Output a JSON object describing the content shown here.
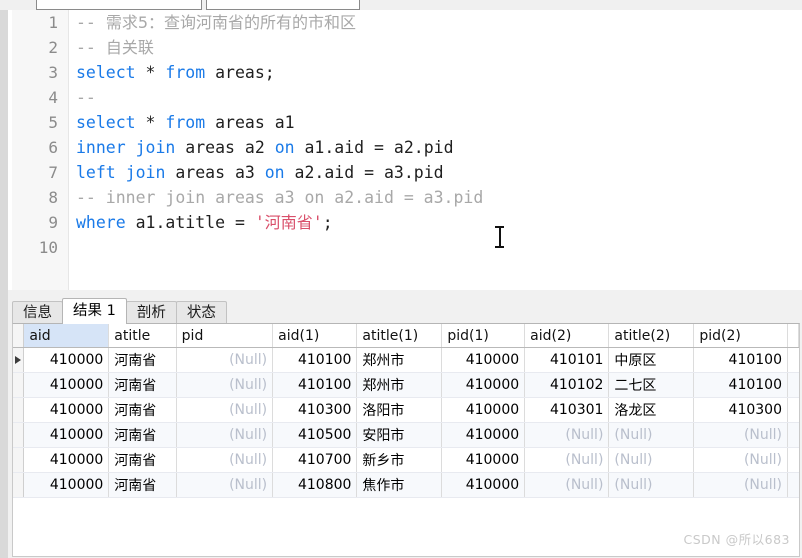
{
  "toolbar": {
    "box_one_label": "",
    "box_two_label": ""
  },
  "editor": {
    "lines": [
      {
        "no": "1",
        "segments": [
          {
            "t": "-- ",
            "c": "cm"
          },
          {
            "t": "需求5：查询河南省的所有的市和区",
            "c": "cm cn"
          }
        ]
      },
      {
        "no": "2",
        "segments": [
          {
            "t": "-- ",
            "c": "cm"
          },
          {
            "t": "自关联",
            "c": "cm cn"
          }
        ]
      },
      {
        "no": "3",
        "segments": [
          {
            "t": "select",
            "c": "kw"
          },
          {
            "t": " * ",
            "c": ""
          },
          {
            "t": "from",
            "c": "kw"
          },
          {
            "t": " areas;",
            "c": ""
          }
        ]
      },
      {
        "no": "4",
        "segments": [
          {
            "t": "--",
            "c": "cm"
          }
        ]
      },
      {
        "no": "5",
        "segments": [
          {
            "t": "select",
            "c": "kw"
          },
          {
            "t": " * ",
            "c": ""
          },
          {
            "t": "from",
            "c": "kw"
          },
          {
            "t": " areas a1",
            "c": ""
          }
        ]
      },
      {
        "no": "6",
        "segments": [
          {
            "t": "inner join",
            "c": "kw"
          },
          {
            "t": " areas a2 ",
            "c": ""
          },
          {
            "t": "on",
            "c": "kw"
          },
          {
            "t": " a1.aid = a2.pid",
            "c": ""
          }
        ]
      },
      {
        "no": "7",
        "segments": [
          {
            "t": "left join",
            "c": "kw"
          },
          {
            "t": " areas a3 ",
            "c": ""
          },
          {
            "t": "on",
            "c": "kw"
          },
          {
            "t": " a2.aid = a3.pid",
            "c": ""
          }
        ]
      },
      {
        "no": "8",
        "segments": [
          {
            "t": "-- inner join areas a3 on a2.aid = a3.pid",
            "c": "cm"
          }
        ]
      },
      {
        "no": "9",
        "segments": [
          {
            "t": "where",
            "c": "kw"
          },
          {
            "t": " a1.atitle = ",
            "c": ""
          },
          {
            "t": "'",
            "c": "str"
          },
          {
            "t": "河南省",
            "c": "str cn"
          },
          {
            "t": "'",
            "c": "str"
          },
          {
            "t": ";",
            "c": ""
          }
        ]
      },
      {
        "no": "10",
        "segments": []
      }
    ]
  },
  "results": {
    "tabs": [
      {
        "label": "信息",
        "active": false
      },
      {
        "label": "结果 1",
        "active": true
      },
      {
        "label": "剖析",
        "active": false
      },
      {
        "label": "状态",
        "active": false
      }
    ],
    "columns": [
      "aid",
      "atitle",
      "pid",
      "aid(1)",
      "atitle(1)",
      "pid(1)",
      "aid(2)",
      "atitle(2)",
      "pid(2)"
    ],
    "selected_column": "aid",
    "null_text": "(Null)",
    "current_row_index": 0,
    "rows": [
      {
        "aid": "410000",
        "atitle": "河南省",
        "pid": "(Null)",
        "aid1": "410100",
        "atitle1": "郑州市",
        "pid1": "410000",
        "aid2": "410101",
        "atitle2": "中原区",
        "pid2": "410100"
      },
      {
        "aid": "410000",
        "atitle": "河南省",
        "pid": "(Null)",
        "aid1": "410100",
        "atitle1": "郑州市",
        "pid1": "410000",
        "aid2": "410102",
        "atitle2": "二七区",
        "pid2": "410100"
      },
      {
        "aid": "410000",
        "atitle": "河南省",
        "pid": "(Null)",
        "aid1": "410300",
        "atitle1": "洛阳市",
        "pid1": "410000",
        "aid2": "410301",
        "atitle2": "洛龙区",
        "pid2": "410300"
      },
      {
        "aid": "410000",
        "atitle": "河南省",
        "pid": "(Null)",
        "aid1": "410500",
        "atitle1": "安阳市",
        "pid1": "410000",
        "aid2": "(Null)",
        "atitle2": "(Null)",
        "pid2": "(Null)"
      },
      {
        "aid": "410000",
        "atitle": "河南省",
        "pid": "(Null)",
        "aid1": "410700",
        "atitle1": "新乡市",
        "pid1": "410000",
        "aid2": "(Null)",
        "atitle2": "(Null)",
        "pid2": "(Null)"
      },
      {
        "aid": "410000",
        "atitle": "河南省",
        "pid": "(Null)",
        "aid1": "410800",
        "atitle1": "焦作市",
        "pid1": "410000",
        "aid2": "(Null)",
        "atitle2": "(Null)",
        "pid2": "(Null)"
      }
    ]
  },
  "watermark": {
    "text": "CSDN @所以683"
  },
  "colors": {
    "keyword": "#1a7ae8",
    "comment": "#a8a8a8",
    "string": "#d94f6a",
    "selected_header": "#d6e4f7",
    "alt_row": "#f7f9fc"
  }
}
